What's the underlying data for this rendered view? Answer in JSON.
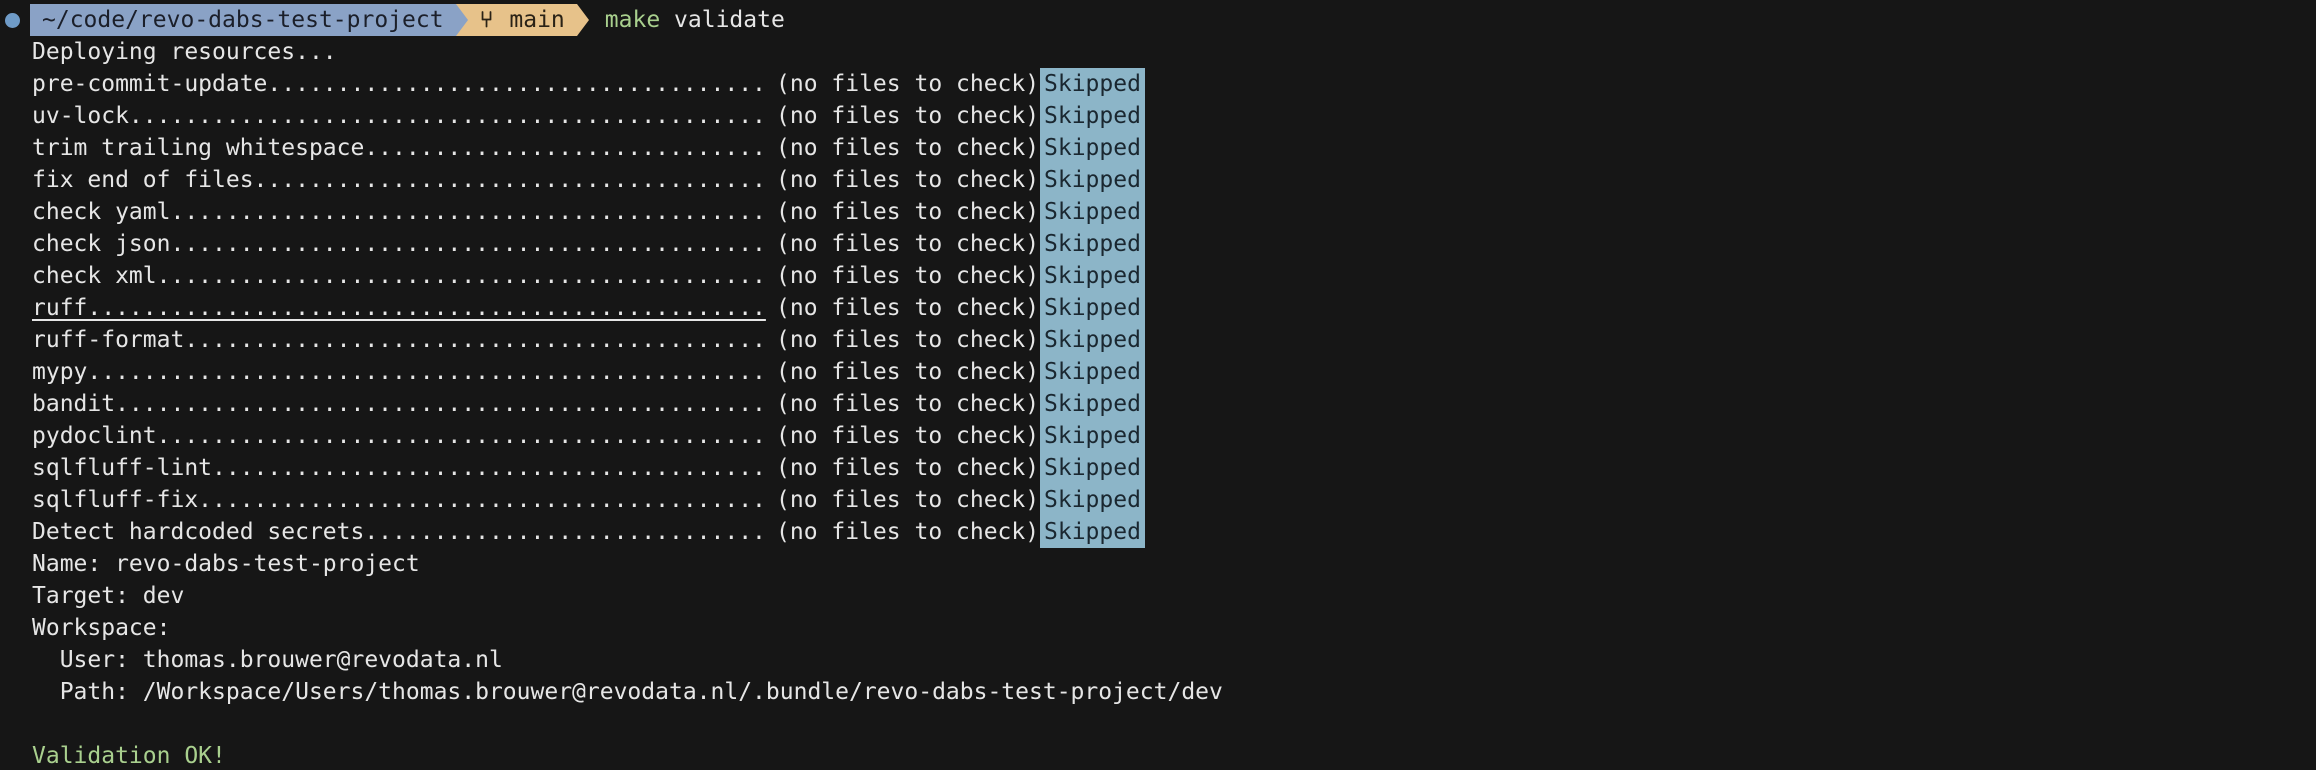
{
  "prompt": {
    "path": "~/code/revo-dabs-test-project",
    "branch": "main",
    "command": "make",
    "argument": "validate"
  },
  "deploying": "Deploying resources...",
  "hooks": [
    {
      "label": "pre-commit-update....................................",
      "note": "(no files to check)",
      "status": "Skipped"
    },
    {
      "label": "uv-lock..............................................",
      "note": "(no files to check)",
      "status": "Skipped"
    },
    {
      "label": "trim trailing whitespace.............................",
      "note": "(no files to check)",
      "status": "Skipped"
    },
    {
      "label": "fix end of files.....................................",
      "note": "(no files to check)",
      "status": "Skipped"
    },
    {
      "label": "check yaml...........................................",
      "note": "(no files to check)",
      "status": "Skipped"
    },
    {
      "label": "check json...........................................",
      "note": "(no files to check)",
      "status": "Skipped"
    },
    {
      "label": "check xml............................................",
      "note": "(no files to check)",
      "status": "Skipped"
    },
    {
      "label": "ruff.................................................",
      "note": "(no files to check)",
      "status": "Skipped"
    },
    {
      "label": "ruff-format..........................................",
      "note": "(no files to check)",
      "status": "Skipped"
    },
    {
      "label": "mypy.................................................",
      "note": "(no files to check)",
      "status": "Skipped"
    },
    {
      "label": "bandit...............................................",
      "note": "(no files to check)",
      "status": "Skipped"
    },
    {
      "label": "pydoclint............................................",
      "note": "(no files to check)",
      "status": "Skipped"
    },
    {
      "label": "sqlfluff-lint........................................",
      "note": "(no files to check)",
      "status": "Skipped"
    },
    {
      "label": "sqlfluff-fix.........................................",
      "note": "(no files to check)",
      "status": "Skipped"
    },
    {
      "label": "Detect hardcoded secrets.............................",
      "note": "(no files to check)",
      "status": "Skipped"
    }
  ],
  "summary": {
    "name": "Name: revo-dabs-test-project",
    "target": "Target: dev",
    "workspace": "Workspace:",
    "user": "  User: thomas.brouwer@revodata.nl",
    "path": "  Path: /Workspace/Users/thomas.brouwer@revodata.nl/.bundle/revo-dabs-test-project/dev"
  },
  "result": "Validation OK!",
  "colors": {
    "background": "#161616",
    "path_segment": "#8aa2c6",
    "git_segment": "#e7c28a",
    "skipped_badge": "#8cb5c8",
    "success": "#a9d08e"
  },
  "icons": {
    "prompt_dot": "status-dot-icon",
    "git_branch": "git-branch-icon"
  }
}
